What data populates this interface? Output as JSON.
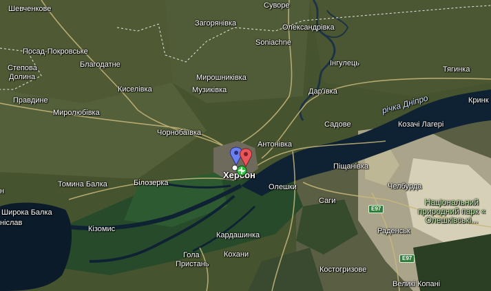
{
  "map": {
    "colors": {
      "land": "#46532f",
      "field": "#55603a",
      "forest": "#2e4a22",
      "water": "#0e1f2e",
      "sand": "#c9c3a2",
      "road": "#c7b77a",
      "border": "#e8e8e8"
    },
    "places": {
      "shevchenkove": "Шевченкове",
      "suvore": "Суворе",
      "zahoryanivka": "Загорянівка",
      "oleksandrivka": "Олександрівка",
      "soniachne": "Soniachne",
      "posad_pokrovske": "Посад-Покровське",
      "blahodatne": "Благодатне",
      "stepova_dolyna_1": "Степова",
      "stepova_dolyna_2": "Долина",
      "inhulets": "Інгулець",
      "tyahynka": "Тягинка",
      "myroshnykivka": "Мирошниківка",
      "muzykivka": "Музиківка",
      "kyselivka": "Киселівка",
      "darivka": "Дар'ївка",
      "pravdyne": "Правдине",
      "myrolyubivka": "Миролюбівка",
      "krynky": "Кринк",
      "chornobayivka": "Чорнобаївка",
      "sadove": "Садове",
      "kozachi_laheri": "Козачі Лагері",
      "antonivka": "Антонівка",
      "kherson": "Херсон",
      "pishchanivka": "Піщанівка",
      "tomyna_balka": "Томина Балка",
      "bilozerka": "Білозерка",
      "oleshky": "Олешки",
      "chelburda": "Челбурда",
      "shyroka_balka": "Широка Балка",
      "stanislav": "ніслав",
      "sahy": "Саги",
      "kizomys": "Кізомис",
      "radensk": "Раденськ",
      "kardashynka": "Кардашинка",
      "hola_prystan_1": "Гола",
      "hola_prystan_2": "Пристань",
      "kokhany": "Кохани",
      "kostohryzove": "Костогризове",
      "velyki_kopani": "Великі Копані",
      "n_dash": "н"
    },
    "river_label": "річка Дніпро",
    "park_label": "Національний природний парк « Олешківські...",
    "road_shields": [
      "E97",
      "E97"
    ],
    "pin_icons": [
      "blue-pin",
      "red-pin",
      "green-plane"
    ]
  }
}
